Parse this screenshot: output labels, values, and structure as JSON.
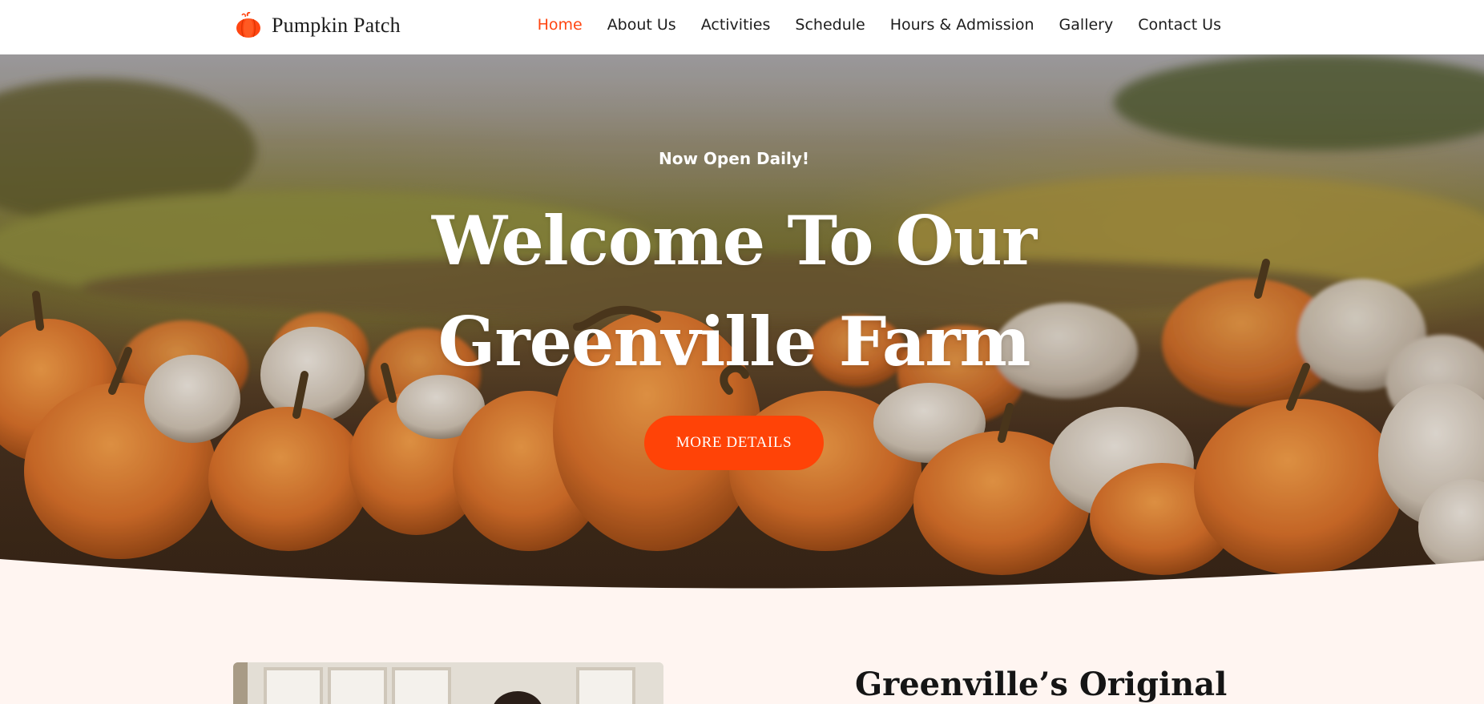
{
  "header": {
    "logo_text": "Pumpkin Patch",
    "logo_icon": "pumpkin-icon",
    "nav": [
      {
        "label": "Home",
        "active": true
      },
      {
        "label": "About Us",
        "active": false
      },
      {
        "label": "Activities",
        "active": false
      },
      {
        "label": "Schedule",
        "active": false
      },
      {
        "label": "Hours & Admission",
        "active": false
      },
      {
        "label": "Gallery",
        "active": false
      },
      {
        "label": "Contact Us",
        "active": false
      }
    ]
  },
  "hero": {
    "subtitle": "Now Open Daily!",
    "title_line1": "Welcome To Our",
    "title_line2": "Greenville Farm",
    "button_label": "MORE DETAILS"
  },
  "intro": {
    "heading": "Greenville’s Original"
  },
  "colors": {
    "accent": "#ff4612",
    "button": "#ff4307",
    "section_bg": "#fff5f1"
  }
}
